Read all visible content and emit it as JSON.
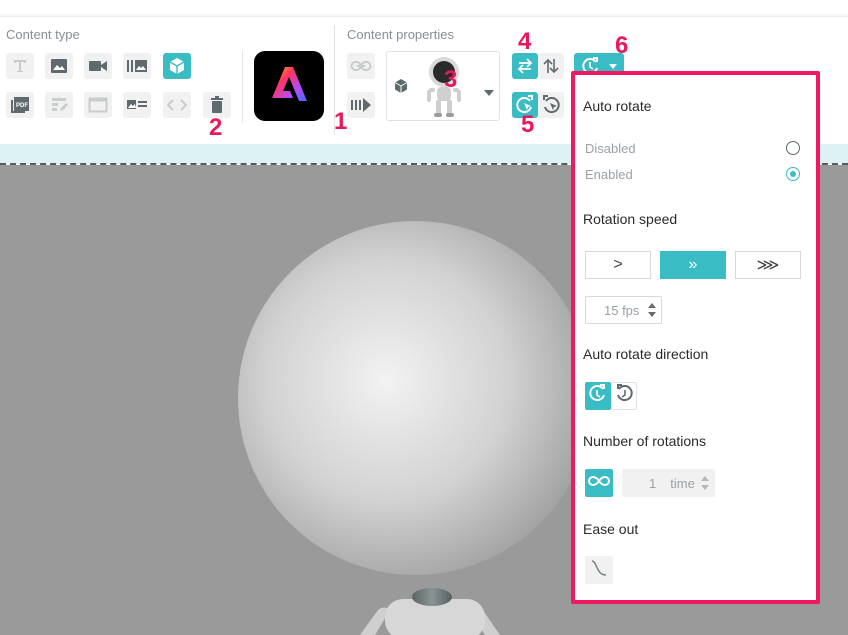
{
  "toolbar": {
    "content_type_title": "Content type",
    "content_properties_title": "Content properties",
    "content_type_buttons": [
      {
        "icon": "text-icon"
      },
      {
        "icon": "image-icon"
      },
      {
        "icon": "video-icon"
      },
      {
        "icon": "gallery-icon"
      },
      {
        "icon": "3d-model-icon",
        "active": true
      },
      {
        "icon": "pdf-icon"
      },
      {
        "icon": "form-icon"
      },
      {
        "icon": "window-icon"
      },
      {
        "icon": "card-icon"
      },
      {
        "icon": "code-icon"
      },
      {
        "icon": "trash-icon"
      }
    ],
    "app_tile_icon": "adobe-express-icon",
    "link_icon": "link-icon",
    "animation_icon": "animation-icon",
    "model_select_icon": "robot-model-thumbnail"
  },
  "badges": {
    "b1": "1",
    "b2": "2",
    "b3": "3",
    "b4": "4",
    "b5": "5",
    "b6": "6"
  },
  "panel": {
    "auto_rotate_label": "Auto rotate",
    "option_disabled": "Disabled",
    "option_enabled": "Enabled",
    "selected_option": "Enabled",
    "rotation_speed_label": "Rotation speed",
    "speed_options": [
      ">",
      "»",
      "⋙"
    ],
    "selected_speed_index": 1,
    "fps_value": "15 fps",
    "direction_label": "Auto rotate direction",
    "rotations_label": "Number of rotations",
    "rotations_value": "1",
    "rotations_unit": "time",
    "ease_out_label": "Ease out"
  },
  "colors": {
    "accent": "#3abcc4",
    "highlight": "#f0185f",
    "canvas": "#9a9a9a"
  }
}
